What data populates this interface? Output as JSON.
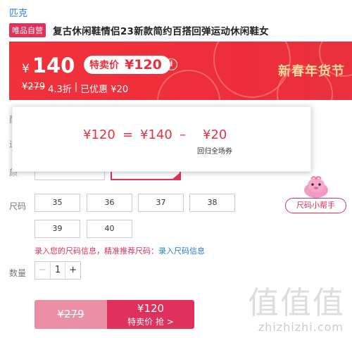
{
  "header": {
    "brand": "匹克",
    "tag": "唯品自营",
    "title": "复古休闲鞋情侣23新款简约百搭回弹运动休闲鞋女"
  },
  "banner": {
    "yen": "¥",
    "price": "140",
    "special_label": "特卖价",
    "special_price": "¥120",
    "info_icon": "info-circle-icon",
    "orig_price": "¥279",
    "discount": "4.3折",
    "divider": "|",
    "saved": "已优惠 ¥20",
    "festival": "新春年货节"
  },
  "clipped_labels": [
    "配",
    "运",
    "颜"
  ],
  "tooltip": {
    "final": "¥120",
    "equals": "=",
    "price": "¥140",
    "minus": "–",
    "coupon": "¥20",
    "coupon_note": "回归全场券"
  },
  "size": {
    "label": "尺码",
    "options": [
      "35",
      "36",
      "37",
      "38",
      "39",
      "40"
    ],
    "helper": "尺码小帮手"
  },
  "hint": {
    "text": "录入您的尺码信息，精准推荐尺码：",
    "link": "录入尺码信息"
  },
  "quantity": {
    "label": "数量",
    "minus": "−",
    "value": "1",
    "plus": "+"
  },
  "buy": {
    "orig": "¥279",
    "price": "¥120",
    "label": "特卖价 抢 >"
  },
  "watermark": {
    "main": "值值值",
    "sub": "zhizhizhi.com"
  },
  "colors": {
    "accent": "#e1305a",
    "banner": "#f1323b",
    "link": "#2a7bd3"
  }
}
